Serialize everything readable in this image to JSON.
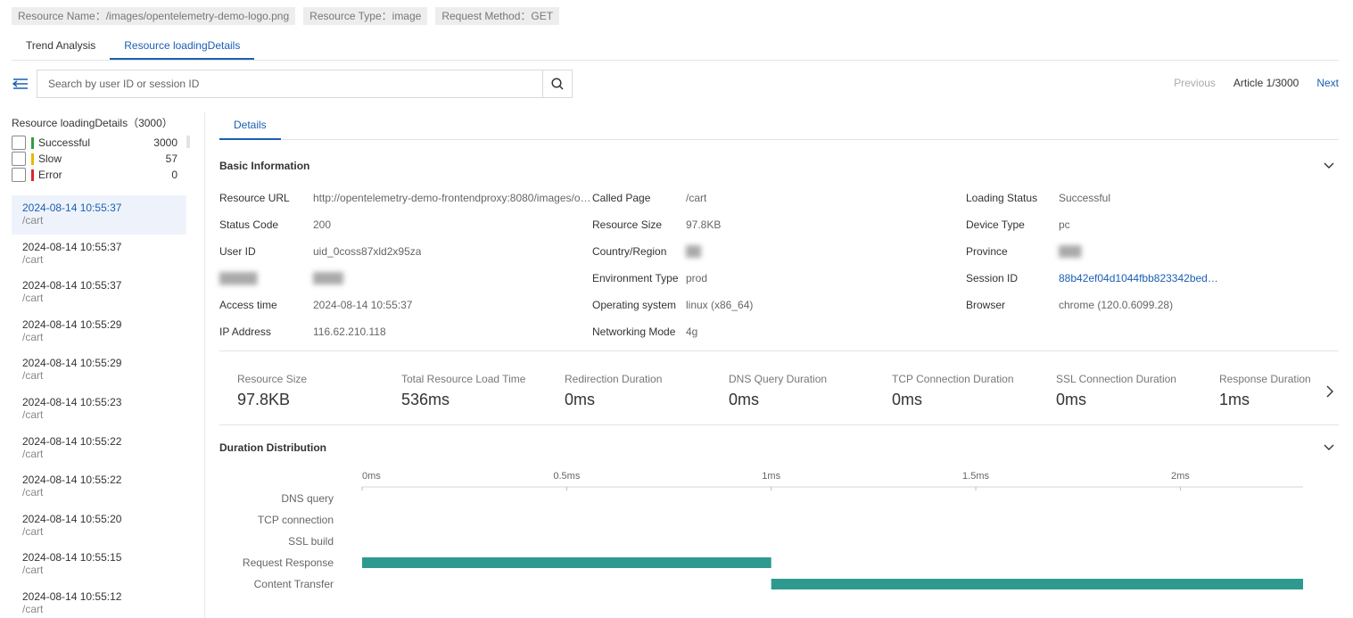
{
  "tags": [
    {
      "label": "Resource Name",
      "value": "/images/opentelemetry-demo-logo.png"
    },
    {
      "label": "Resource Type",
      "value": "image"
    },
    {
      "label": "Request Method",
      "value": "GET"
    }
  ],
  "tag_texts": {
    "t0": "Resource Name：/images/opentelemetry-demo-logo.png",
    "t1": "Resource Type：image",
    "t2": "Request Method：GET"
  },
  "tabs": {
    "trend": "Trend Analysis",
    "details": "Resource loadingDetails"
  },
  "search": {
    "placeholder": "Search by user ID or session ID"
  },
  "pager": {
    "previous": "Previous",
    "current": "Article 1/3000",
    "next": "Next"
  },
  "left": {
    "title": "Resource loadingDetails（3000）",
    "filters": [
      {
        "label": "Successful",
        "count": "3000",
        "color": "#2e9e3e"
      },
      {
        "label": "Slow",
        "count": "57",
        "color": "#e6b800"
      },
      {
        "label": "Error",
        "count": "0",
        "color": "#d9262c"
      }
    ],
    "records": [
      {
        "time": "2024-08-14 10:55:37",
        "page": "/cart"
      },
      {
        "time": "2024-08-14 10:55:37",
        "page": "/cart"
      },
      {
        "time": "2024-08-14 10:55:37",
        "page": "/cart"
      },
      {
        "time": "2024-08-14 10:55:29",
        "page": "/cart"
      },
      {
        "time": "2024-08-14 10:55:29",
        "page": "/cart"
      },
      {
        "time": "2024-08-14 10:55:23",
        "page": "/cart"
      },
      {
        "time": "2024-08-14 10:55:22",
        "page": "/cart"
      },
      {
        "time": "2024-08-14 10:55:22",
        "page": "/cart"
      },
      {
        "time": "2024-08-14 10:55:20",
        "page": "/cart"
      },
      {
        "time": "2024-08-14 10:55:15",
        "page": "/cart"
      },
      {
        "time": "2024-08-14 10:55:12",
        "page": "/cart"
      }
    ]
  },
  "details": {
    "tab": "Details",
    "basic_title": "Basic Information",
    "col1": [
      {
        "label": "Resource URL",
        "value": "http://opentelemetry-demo-frontendproxy:8080/images/opentelemetry-demo-logo.png"
      },
      {
        "label": "Status Code",
        "value": "200"
      },
      {
        "label": "User ID",
        "value": "uid_0coss87xld2x95za"
      },
      {
        "label": "Access time",
        "value": "2024-08-14 10:55:37"
      },
      {
        "label": "IP Address",
        "value": "116.62.210.118"
      }
    ],
    "col2": [
      {
        "label": "Called Page",
        "value": "/cart"
      },
      {
        "label": "Resource Size",
        "value": "97.8KB"
      },
      {
        "label": "Country/Region",
        "value": ""
      },
      {
        "label": "Environment Type",
        "value": "prod"
      },
      {
        "label": "Operating system",
        "value": "linux (x86_64)"
      },
      {
        "label": "Networking Mode",
        "value": "4g"
      }
    ],
    "col3": [
      {
        "label": "Loading Status",
        "value": "Successful"
      },
      {
        "label": "Device Type",
        "value": "pc"
      },
      {
        "label": "Province",
        "value": ""
      },
      {
        "label": "Session ID",
        "value": "88b42ef04d1044fbb823342bed…"
      },
      {
        "label": "Browser",
        "value": "chrome (120.0.6099.28)"
      }
    ],
    "metrics": [
      {
        "label": "Resource Size",
        "value": "97.8KB"
      },
      {
        "label": "Total Resource Load Time",
        "value": "536ms"
      },
      {
        "label": "Redirection Duration",
        "value": "0ms"
      },
      {
        "label": "DNS Query Duration",
        "value": "0ms"
      },
      {
        "label": "TCP Connection Duration",
        "value": "0ms"
      },
      {
        "label": "SSL Connection Duration",
        "value": "0ms"
      },
      {
        "label": "Response Duration",
        "value": "1ms"
      }
    ],
    "duration_title": "Duration Distribution"
  },
  "chart_data": {
    "type": "bar",
    "orientation": "horizontal-range",
    "x_ticks": [
      "0ms",
      "0.5ms",
      "1ms",
      "1.5ms",
      "2ms"
    ],
    "xlim": [
      0,
      2.3
    ],
    "categories": [
      "DNS query",
      "TCP connection",
      "SSL build",
      "Request Response",
      "Content Transfer"
    ],
    "ranges": [
      [
        0,
        0
      ],
      [
        0,
        0
      ],
      [
        0,
        0
      ],
      [
        0,
        1.0
      ],
      [
        1.0,
        2.3
      ]
    ],
    "bar_color": "#2e9a8f",
    "grid": false
  }
}
